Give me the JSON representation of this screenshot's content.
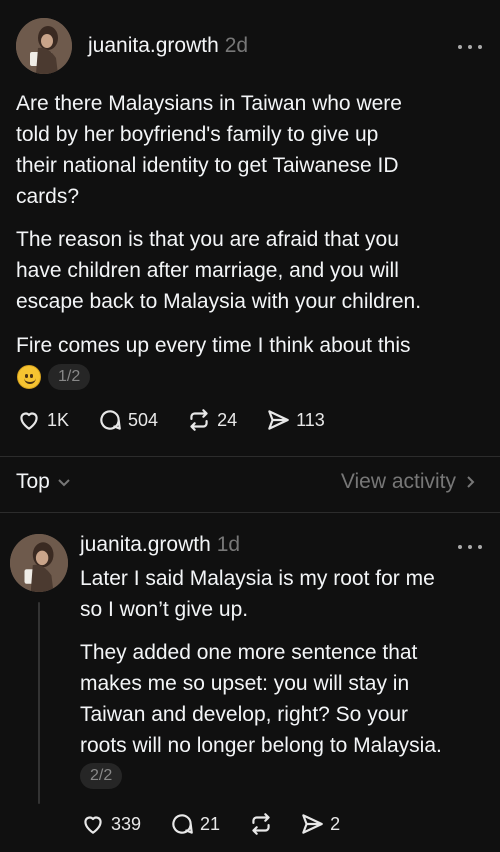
{
  "post": {
    "username": "juanita.growth",
    "time": "2d",
    "paragraph1": "Are there Malaysians in Taiwan who were\ntold by her boyfriend's family to give up\ntheir national identity to get Taiwanese ID\ncards?",
    "paragraph2": "The reason is that you are afraid that you\nhave children after marriage, and you will\nescape back to Malaysia with your children.",
    "paragraph3": "Fire comes up every time I think about this",
    "page_indicator": "1/2",
    "likes": "1K",
    "replies": "504",
    "reposts": "24",
    "shares": "113"
  },
  "sort_bar": {
    "sort_label": "Top",
    "view_activity": "View activity"
  },
  "reply": {
    "username": "juanita.growth",
    "time": "1d",
    "paragraph1": "Later I said Malaysia is my root for me\nso I won’t give up.",
    "paragraph2": "They added one more sentence that\nmakes me so upset: you will stay in\nTaiwan and develop, right? So your\nroots will no longer belong to Malaysia.",
    "page_indicator": "2/2",
    "likes": "339",
    "replies": "21",
    "reposts": "",
    "shares": "2"
  },
  "icons": {
    "like": "heart-icon",
    "reply": "comment-bubble-icon",
    "repost": "repost-icon",
    "share": "send-icon",
    "more": "more-dots-icon",
    "emoji": "slightly-smiling-face-emoji"
  },
  "colors": {
    "background": "#101010",
    "text": "#f3f5f7",
    "muted": "#777777"
  }
}
